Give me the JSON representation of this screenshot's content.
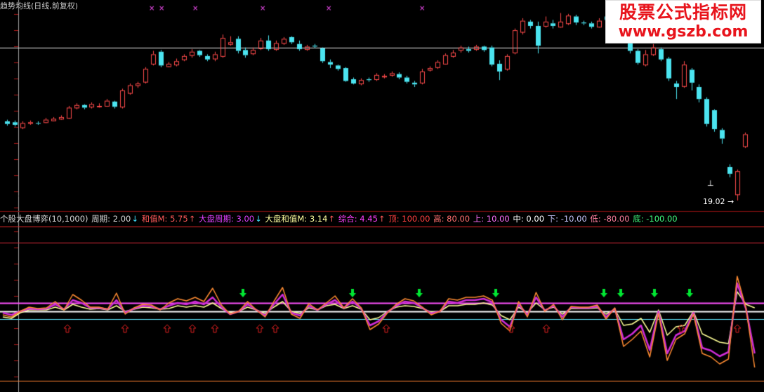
{
  "header": {
    "title": "趋势均线(日线,前复权)"
  },
  "watermark": {
    "line1": "股票公式指标网",
    "line2": "www.gszb.com"
  },
  "price_label": "19.02",
  "legend": [
    {
      "text": "个股大盘博弈(10,1000)",
      "color": "#d8d8d8"
    },
    {
      "text": " 周期: 2.00",
      "color": "#d8d8d8"
    },
    {
      "text": "↓",
      "color": "#40e0ff"
    },
    {
      "text": " 和值M: 5.75",
      "color": "#ff5a5a"
    },
    {
      "text": "↑",
      "color": "#ff5a5a"
    },
    {
      "text": " 大盘周期: 3.00",
      "color": "#e040ff"
    },
    {
      "text": "↓",
      "color": "#40e0ff"
    },
    {
      "text": " 大盘和值M: 3.14",
      "color": "#ffffa0"
    },
    {
      "text": "↑",
      "color": "#ff5a5a"
    },
    {
      "text": " 综合: 4.45",
      "color": "#ff40ff"
    },
    {
      "text": "↑",
      "color": "#ff5a5a"
    },
    {
      "text": "   顶: 100.00",
      "color": "#ff4040"
    },
    {
      "text": " 高: 80.00",
      "color": "#ff7070"
    },
    {
      "text": " 上: 10.00",
      "color": "#ff70ff"
    },
    {
      "text": " 中: 0.00",
      "color": "#ffffff"
    },
    {
      "text": " 下: -10.00",
      "color": "#c8c8ff"
    },
    {
      "text": " 低: -80.00",
      "color": "#ff80a0"
    },
    {
      "text": " 底: -100.00",
      "color": "#40ff80"
    }
  ],
  "colors": {
    "up": "#ff4b4b",
    "down": "#4be4f0",
    "orange": "#ff8c32",
    "purple": "#d02cd8",
    "yellow": "#ffff96",
    "cyan": "#30f0f0",
    "white": "#ffffff",
    "green": "#00e632",
    "magenta": "#ff50ff"
  },
  "chart_data": [
    {
      "type": "candlestick",
      "candles": [
        {
          "o": 28.2,
          "c": 27.9,
          "h": 28.4,
          "l": 27.7
        },
        {
          "o": 28.1,
          "c": 27.8,
          "h": 28.3,
          "l": 27.6
        },
        {
          "o": 27.5,
          "c": 28.0,
          "h": 28.2,
          "l": 27.3
        },
        {
          "o": 28.0,
          "c": 28.1,
          "h": 28.3,
          "l": 27.8
        },
        {
          "o": 28.0,
          "c": 27.95,
          "h": 28.2,
          "l": 27.8
        },
        {
          "o": 28.1,
          "c": 28.4,
          "h": 28.6,
          "l": 28.0
        },
        {
          "o": 28.3,
          "c": 28.5,
          "h": 28.7,
          "l": 28.2
        },
        {
          "o": 28.5,
          "c": 28.7,
          "h": 28.9,
          "l": 28.4
        },
        {
          "o": 28.6,
          "c": 29.8,
          "h": 30.0,
          "l": 28.5
        },
        {
          "o": 29.8,
          "c": 30.1,
          "h": 30.3,
          "l": 29.6
        },
        {
          "o": 30.1,
          "c": 29.8,
          "h": 30.2,
          "l": 29.6
        },
        {
          "o": 29.9,
          "c": 30.2,
          "h": 30.4,
          "l": 29.7
        },
        {
          "o": 30.0,
          "c": 30.0,
          "h": 30.3,
          "l": 29.8
        },
        {
          "o": 30.0,
          "c": 30.6,
          "h": 30.8,
          "l": 29.9
        },
        {
          "o": 30.5,
          "c": 29.9,
          "h": 30.6,
          "l": 29.7
        },
        {
          "o": 29.9,
          "c": 31.8,
          "h": 32.0,
          "l": 29.7
        },
        {
          "o": 31.5,
          "c": 32.4,
          "h": 32.6,
          "l": 31.3
        },
        {
          "o": 32.4,
          "c": 32.6,
          "h": 32.8,
          "l": 32.1
        },
        {
          "o": 32.8,
          "c": 34.3,
          "h": 34.5,
          "l": 32.6
        },
        {
          "o": 34.9,
          "c": 36.0,
          "h": 36.4,
          "l": 34.7
        },
        {
          "o": 36.3,
          "c": 34.7,
          "h": 36.5,
          "l": 34.5
        },
        {
          "o": 34.6,
          "c": 34.9,
          "h": 35.1,
          "l": 34.5
        },
        {
          "o": 34.8,
          "c": 35.2,
          "h": 35.5,
          "l": 34.6
        },
        {
          "o": 35.4,
          "c": 35.8,
          "h": 36.0,
          "l": 35.2
        },
        {
          "o": 35.9,
          "c": 36.3,
          "h": 36.6,
          "l": 35.6
        },
        {
          "o": 36.4,
          "c": 35.9,
          "h": 36.5,
          "l": 35.7
        },
        {
          "o": 35.8,
          "c": 35.4,
          "h": 36.0,
          "l": 35.2
        },
        {
          "o": 35.5,
          "c": 36.0,
          "h": 36.3,
          "l": 35.2
        },
        {
          "o": 35.8,
          "c": 37.9,
          "h": 38.3,
          "l": 35.6
        },
        {
          "o": 37.2,
          "c": 37.4,
          "h": 38.1,
          "l": 37.0
        },
        {
          "o": 37.8,
          "c": 36.4,
          "h": 38.1,
          "l": 36.1
        },
        {
          "o": 36.5,
          "c": 35.9,
          "h": 36.8,
          "l": 35.6
        },
        {
          "o": 36.1,
          "c": 36.5,
          "h": 36.8,
          "l": 35.9
        },
        {
          "o": 36.7,
          "c": 37.6,
          "h": 37.9,
          "l": 36.5
        },
        {
          "o": 37.6,
          "c": 36.6,
          "h": 38.2,
          "l": 36.4
        },
        {
          "o": 36.6,
          "c": 37.3,
          "h": 37.6,
          "l": 36.4
        },
        {
          "o": 37.3,
          "c": 37.8,
          "h": 38.0,
          "l": 37.1
        },
        {
          "o": 38.0,
          "c": 37.4,
          "h": 38.1,
          "l": 37.2
        },
        {
          "o": 37.2,
          "c": 36.6,
          "h": 37.6,
          "l": 36.4
        },
        {
          "o": 36.6,
          "c": 36.9,
          "h": 37.1,
          "l": 36.4
        },
        {
          "o": 37.0,
          "c": 36.9,
          "h": 37.2,
          "l": 36.7
        },
        {
          "o": 36.7,
          "c": 35.2,
          "h": 36.8,
          "l": 35.0
        },
        {
          "o": 35.1,
          "c": 34.8,
          "h": 35.4,
          "l": 34.4
        },
        {
          "o": 34.7,
          "c": 34.3,
          "h": 34.8,
          "l": 34.1
        },
        {
          "o": 34.4,
          "c": 32.9,
          "h": 34.5,
          "l": 32.8
        },
        {
          "o": 33.1,
          "c": 32.6,
          "h": 33.3,
          "l": 32.5
        },
        {
          "o": 32.6,
          "c": 33.0,
          "h": 33.2,
          "l": 32.4
        },
        {
          "o": 33.1,
          "c": 33.0,
          "h": 33.3,
          "l": 32.8
        },
        {
          "o": 33.1,
          "c": 33.6,
          "h": 33.8,
          "l": 32.9
        },
        {
          "o": 33.4,
          "c": 33.5,
          "h": 33.7,
          "l": 33.2
        },
        {
          "o": 33.6,
          "c": 33.8,
          "h": 34.0,
          "l": 33.4
        },
        {
          "o": 33.7,
          "c": 33.3,
          "h": 33.9,
          "l": 33.1
        },
        {
          "o": 33.3,
          "c": 32.8,
          "h": 33.5,
          "l": 32.6
        },
        {
          "o": 32.7,
          "c": 32.5,
          "h": 32.9,
          "l": 32.2
        },
        {
          "o": 32.7,
          "c": 34.0,
          "h": 34.3,
          "l": 32.5
        },
        {
          "o": 34.2,
          "c": 34.4,
          "h": 34.6,
          "l": 34.0
        },
        {
          "o": 34.5,
          "c": 35.1,
          "h": 35.3,
          "l": 34.3
        },
        {
          "o": 34.9,
          "c": 35.9,
          "h": 36.1,
          "l": 34.8
        },
        {
          "o": 35.8,
          "c": 36.2,
          "h": 36.5,
          "l": 35.6
        },
        {
          "o": 36.5,
          "c": 36.8,
          "h": 37.0,
          "l": 36.2
        },
        {
          "o": 36.6,
          "c": 36.4,
          "h": 36.9,
          "l": 36.2
        },
        {
          "o": 36.6,
          "c": 36.9,
          "h": 37.1,
          "l": 36.4
        },
        {
          "o": 36.9,
          "c": 36.5,
          "h": 37.0,
          "l": 36.3
        },
        {
          "o": 36.8,
          "c": 34.8,
          "h": 37.0,
          "l": 34.6
        },
        {
          "o": 34.9,
          "c": 34.0,
          "h": 35.3,
          "l": 33.0
        },
        {
          "o": 34.3,
          "c": 35.8,
          "h": 36.0,
          "l": 34.1
        },
        {
          "o": 36.2,
          "c": 38.8,
          "h": 39.0,
          "l": 36.0
        },
        {
          "o": 38.6,
          "c": 39.9,
          "h": 40.2,
          "l": 38.3
        },
        {
          "o": 39.8,
          "c": 39.3,
          "h": 40.0,
          "l": 39.0
        },
        {
          "o": 39.3,
          "c": 37.0,
          "h": 39.8,
          "l": 36.1
        },
        {
          "o": 39.3,
          "c": 39.8,
          "h": 40.4,
          "l": 39.1
        },
        {
          "o": 39.6,
          "c": 39.3,
          "h": 40.0,
          "l": 39.0
        },
        {
          "o": 39.2,
          "c": 39.8,
          "h": 40.8,
          "l": 39.1
        },
        {
          "o": 39.6,
          "c": 40.5,
          "h": 40.7,
          "l": 39.4
        },
        {
          "o": 40.4,
          "c": 39.7,
          "h": 40.6,
          "l": 39.4
        },
        {
          "o": 39.7,
          "c": 39.6,
          "h": 39.9,
          "l": 39.4
        },
        {
          "o": 39.6,
          "c": 39.2,
          "h": 39.8,
          "l": 39.0
        },
        {
          "o": 39.2,
          "c": 39.9,
          "h": 40.2,
          "l": 39.1
        },
        {
          "o": 40.4,
          "c": 40.0,
          "h": 40.7,
          "l": 39.6
        },
        {
          "o": 40.7,
          "c": 38.8,
          "h": 41.0,
          "l": 38.6
        },
        {
          "o": 38.6,
          "c": 38.2,
          "h": 39.4,
          "l": 38.0
        },
        {
          "o": 38.5,
          "c": 36.4,
          "h": 38.7,
          "l": 36.1
        },
        {
          "o": 36.4,
          "c": 35.0,
          "h": 36.6,
          "l": 34.8
        },
        {
          "o": 34.8,
          "c": 36.0,
          "h": 36.5,
          "l": 34.6
        },
        {
          "o": 36.0,
          "c": 36.8,
          "h": 37.2,
          "l": 35.8
        },
        {
          "o": 36.6,
          "c": 35.4,
          "h": 36.8,
          "l": 35.2
        },
        {
          "o": 35.5,
          "c": 33.2,
          "h": 35.7,
          "l": 32.9
        },
        {
          "o": 32.6,
          "c": 32.2,
          "h": 32.9,
          "l": 30.8
        },
        {
          "o": 32.3,
          "c": 34.8,
          "h": 35.2,
          "l": 32.1
        },
        {
          "o": 34.2,
          "c": 32.7,
          "h": 34.4,
          "l": 31.8
        },
        {
          "o": 32.2,
          "c": 30.8,
          "h": 32.5,
          "l": 30.4
        },
        {
          "o": 30.8,
          "c": 27.9,
          "h": 31.0,
          "l": 27.6
        },
        {
          "o": 29.5,
          "c": 27.3,
          "h": 29.6,
          "l": 27.0
        },
        {
          "o": 27.2,
          "c": 26.2,
          "h": 27.4,
          "l": 25.6
        },
        {
          "o": 22.9,
          "c": 22.1,
          "h": 23.2,
          "l": 21.7
        },
        {
          "o": 19.7,
          "c": 22.4,
          "h": 22.6,
          "l": 19.0
        },
        {
          "o": 25.3,
          "c": 26.7,
          "h": 26.9,
          "l": 25.1
        }
      ]
    },
    {
      "type": "line",
      "ylim": [
        -100,
        100
      ],
      "levels": [
        100,
        80,
        10,
        0,
        -10,
        -80,
        -100
      ],
      "series": [
        {
          "values": [
            -5,
            -8,
            0,
            6,
            4,
            5,
            14,
            2,
            24,
            16,
            6,
            6,
            3,
            26,
            -4,
            5,
            10,
            9,
            2,
            12,
            18,
            15,
            20,
            14,
            33,
            9,
            -4,
            0,
            14,
            2,
            -8,
            14,
            34,
            -4,
            -10,
            11,
            2,
            12,
            22,
            5,
            18,
            5,
            -26,
            -18,
            -2,
            10,
            18,
            15,
            6,
            -5,
            0,
            18,
            16,
            20,
            20,
            22,
            16,
            -17,
            -28,
            14,
            -8,
            27,
            0,
            10,
            -12,
            7,
            6,
            6,
            9,
            -11,
            5,
            -50,
            -40,
            -28,
            -65,
            -3,
            -70,
            -40,
            -32,
            -4,
            -60,
            -65,
            -75,
            -68,
            50,
            5,
            -80
          ]
        },
        {
          "values": [
            -2,
            -5,
            0,
            4,
            3,
            4,
            10,
            3,
            16,
            12,
            5,
            5,
            3,
            16,
            -2,
            4,
            8,
            7,
            3,
            8,
            12,
            10,
            14,
            10,
            20,
            6,
            -4,
            0,
            10,
            2,
            -6,
            10,
            24,
            -2,
            -6,
            8,
            2,
            10,
            16,
            5,
            14,
            4,
            -20,
            -14,
            -1,
            8,
            14,
            12,
            5,
            -3,
            0,
            14,
            12,
            16,
            16,
            18,
            13,
            -12,
            -22,
            10,
            -5,
            20,
            1,
            8,
            -8,
            6,
            5,
            5,
            7,
            -8,
            4,
            -40,
            -32,
            -20,
            -55,
            0,
            -60,
            -34,
            -28,
            -2,
            -52,
            -56,
            -64,
            -58,
            40,
            4,
            -60
          ]
        },
        {
          "values": [
            -8,
            -10,
            -2,
            2,
            2,
            2,
            6,
            2,
            10,
            6,
            3,
            4,
            2,
            8,
            0,
            3,
            6,
            5,
            3,
            4,
            8,
            6,
            8,
            6,
            12,
            4,
            -2,
            0,
            6,
            2,
            -3,
            6,
            14,
            0,
            -3,
            5,
            2,
            8,
            10,
            4,
            8,
            3,
            -12,
            -9,
            0,
            6,
            8,
            7,
            4,
            -1,
            0,
            8,
            8,
            10,
            10,
            12,
            9,
            -6,
            -12,
            6,
            -2,
            12,
            2,
            6,
            -4,
            4,
            4,
            4,
            5,
            -4,
            3,
            -20,
            -18,
            -10,
            -30,
            2,
            -34,
            -22,
            -20,
            0,
            -32,
            -38,
            -44,
            -46,
            28,
            10,
            5
          ]
        }
      ],
      "arrows_down": [
        19,
        50,
        69,
        83,
        87,
        90,
        98,
        104
      ],
      "arrows_up": [
        10,
        19,
        26,
        30,
        40,
        42,
        55,
        62,
        72,
        84,
        98
      ]
    }
  ]
}
